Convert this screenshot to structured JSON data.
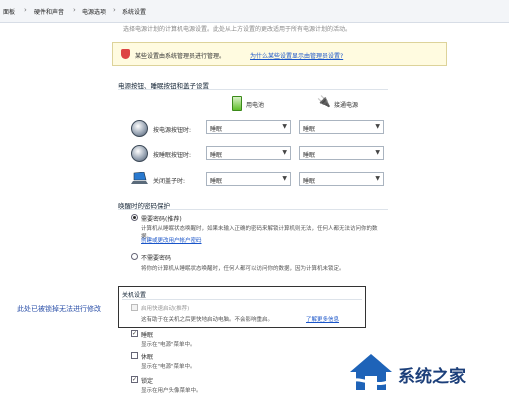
{
  "breadcrumb": {
    "items": [
      "面板",
      "硬件和声音",
      "电源选项",
      "系统设置"
    ],
    "separator": "›"
  },
  "top_cut_text": "选择电源计划的计算机电源设置。此处从上方设置的更改适用于所有电源计划的活动。",
  "notice": {
    "text": "某些设置由系统管理员进行管理。",
    "link": "为什么某些设置显示由管理员设置?"
  },
  "power_buttons": {
    "section_title": "电源按钮、睡眠按钮和盖子设置",
    "columns": [
      "用电池",
      "接通电源"
    ],
    "rows": [
      {
        "label": "按电源按钮时:",
        "battery": "睡眠",
        "plugged": "睡眠"
      },
      {
        "label": "按睡眠按钮时:",
        "battery": "睡眠",
        "plugged": "睡眠"
      },
      {
        "label": "关闭盖子时:",
        "battery": "睡眠",
        "plugged": "睡眠"
      }
    ],
    "dropdown_arrow": "▼"
  },
  "wake_password": {
    "section_title": "唤醒时的密码保护",
    "require_label": "需要密码(推荐)",
    "require_desc_1": "计算机从睡眠状态唤醒时，如果未输入正确的密码来解锁计算机则无法，任何人都无法访问你的数",
    "require_desc_2": "据。",
    "require_link": "创建或更改用户帐户密码",
    "norequire_label": "不需要密码",
    "norequire_desc": "将你的计算机从睡眠状态唤醒时，任何人都可以访问你的数据，因为计算机未锁定。"
  },
  "shutdown": {
    "section_title": "关机设置",
    "fast_startup_label": "启用快速启动(推荐)",
    "fast_startup_desc": "这有助于在关机之后更快地启动电脑。不会影响重启。",
    "fast_startup_link": "了解更多信息",
    "items": [
      {
        "label": "睡眠",
        "desc": "显示在\"电源\"菜单中。",
        "checked": true
      },
      {
        "label": "休眠",
        "desc": "显示在\"电源\"菜单中。",
        "checked": false
      },
      {
        "label": "锁定",
        "desc": "显示在用户头像菜单中。",
        "checked": true
      }
    ]
  },
  "annotation": "此处已被锁掉无法进行修改",
  "watermark": "系统之家",
  "colors": {
    "link": "#1a55c9",
    "annotation": "#2a4fa8",
    "notice_bg": "#fffbe0",
    "watermark": "#1c3f7a"
  }
}
